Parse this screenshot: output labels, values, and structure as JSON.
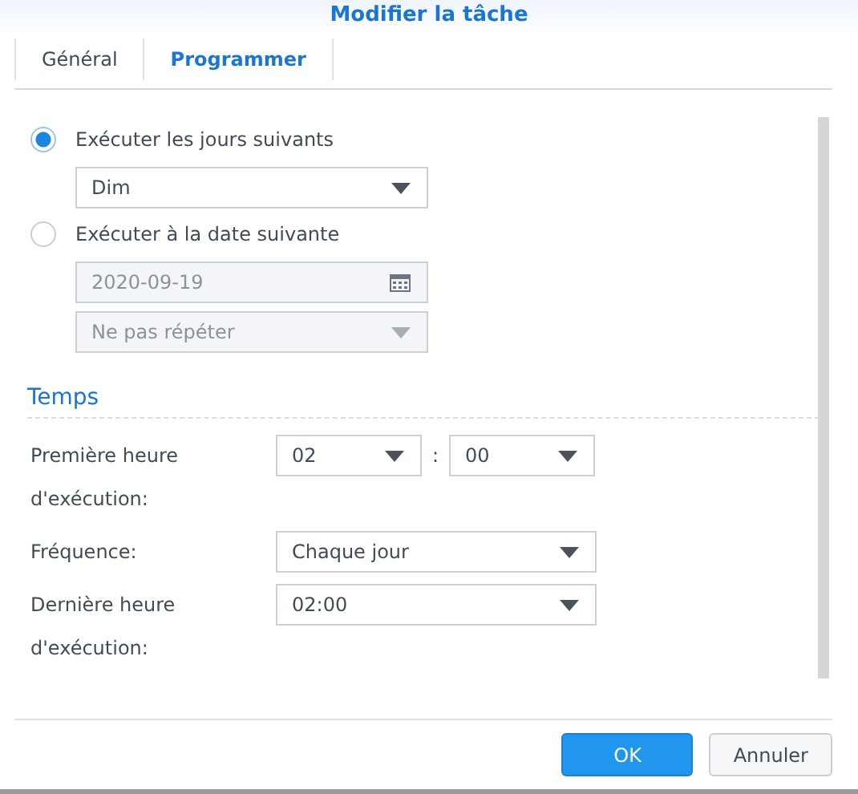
{
  "window": {
    "title": "Modifier la tâche"
  },
  "tabs": [
    {
      "label": "Général",
      "selected": false
    },
    {
      "label": "Programmer",
      "selected": true
    }
  ],
  "schedule": {
    "options": [
      {
        "label": "Exécuter les jours suivants",
        "selected": true,
        "fields": [
          {
            "kind": "select",
            "value": "Dim",
            "disabled": false
          }
        ]
      },
      {
        "label": "Exécuter à la date suivante",
        "selected": false,
        "fields": [
          {
            "kind": "date",
            "value": "2020-09-19",
            "disabled": true
          },
          {
            "kind": "select",
            "value": "Ne pas répéter",
            "disabled": true
          }
        ]
      }
    ]
  },
  "time": {
    "heading": "Temps",
    "rows": [
      {
        "label": "Première heure d'exécution:",
        "fields": [
          {
            "kind": "select",
            "value": "02",
            "disabled": false
          },
          {
            "kind": "separator",
            "value": ":"
          },
          {
            "kind": "select",
            "value": "00",
            "disabled": false
          }
        ]
      },
      {
        "label": "Fréquence:",
        "fields": [
          {
            "kind": "select",
            "value": "Chaque jour",
            "disabled": false
          }
        ]
      },
      {
        "label": "Dernière heure d'exécution:",
        "fields": [
          {
            "kind": "select",
            "value": "02:00",
            "disabled": false
          }
        ]
      }
    ]
  },
  "buttons": [
    {
      "label": "OK",
      "kind": "primary"
    },
    {
      "label": "Annuler",
      "kind": "secondary"
    }
  ]
}
